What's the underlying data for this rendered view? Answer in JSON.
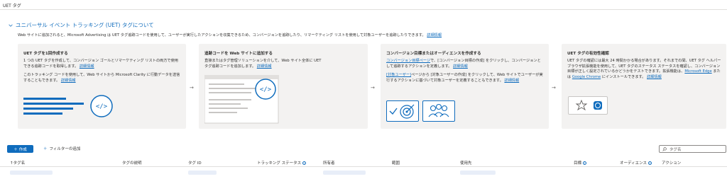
{
  "header": {
    "title": "UET タグ"
  },
  "section": {
    "title": "ユニバーサル イベント トラッキング (UET) タグについて",
    "intro": "Web サイトに追加されると、Microsoft Advertising は UET タグ追跡コードを使用して、ユーザーが実行したアクションを収集できるため、コンバージョンを追跡したり、リマーケティング リストを使用して対象ユーザーを追跡したりできます。",
    "intro_link": "詳細情報"
  },
  "cards": [
    {
      "title": "UET タグを1回作成する",
      "text1": "1 つの UET タグを作成して、コンバージョン ゴールとリマーケティング リストの両方で使用できる追跡コードを取得します。",
      "link1": "詳細情報",
      "text2": "このトラッキング コードを使用して、Web サイトから Microsoft Clarity に行動データを送信することもできます。",
      "link2": "詳細情報"
    },
    {
      "title": "追跡コードを Web サイトに追加する",
      "text1": "直接またはタグ管理ソリューションを介して、Web サイト全体に UET タグ追跡コードを追加します。",
      "link1": "詳細情報"
    },
    {
      "title": "コンバージョン目標またはオーディエンスを作成する",
      "link_a": "コンバージョン目標ページ",
      "text1": "で、[コンバージョン目標の作成] をクリックし、コンバージョンとして追跡するアクションを定義します。",
      "link1": "詳細情報",
      "link_b": "[対象ユーザー]",
      "text2": "ページから [対象ユーザーの作成] をクリックして、Web サイトでユーザーが実行するアクションに基づいて対象ユーザーを定義することもできます。",
      "link2": "詳細情報"
    },
    {
      "title": "UET タグの有効性確認",
      "text1": "UET タグの確認には最大 24 時間かかる場合があります。それまでの間、UET タグ ヘルパー ブラウザ拡張機能を使用して、UET タグのステータス ステータスを確認し、コンバージョン目標が正しく設定されているかどうかをテストできます。拡張機能は、",
      "link_a": "Microsoft Edge",
      "text_mid": " または ",
      "link_b": "Google Chrome",
      "text2": " にインストールできます。",
      "link1": "詳細情報"
    }
  ],
  "toolbar": {
    "create_label": "作成",
    "filter_label": "フィルターの追加"
  },
  "search": {
    "placeholder": "タグ名"
  },
  "table": {
    "columns": [
      "↑タグ名",
      "タグの説明",
      "タグ ID",
      "トラッキング ステータス",
      "所有者",
      "範囲",
      "使用先",
      "目標",
      "オーディエンス",
      "アクション"
    ]
  },
  "colors": {
    "accent": "#0f6cbd",
    "card_bg": "#f3f2f1"
  }
}
